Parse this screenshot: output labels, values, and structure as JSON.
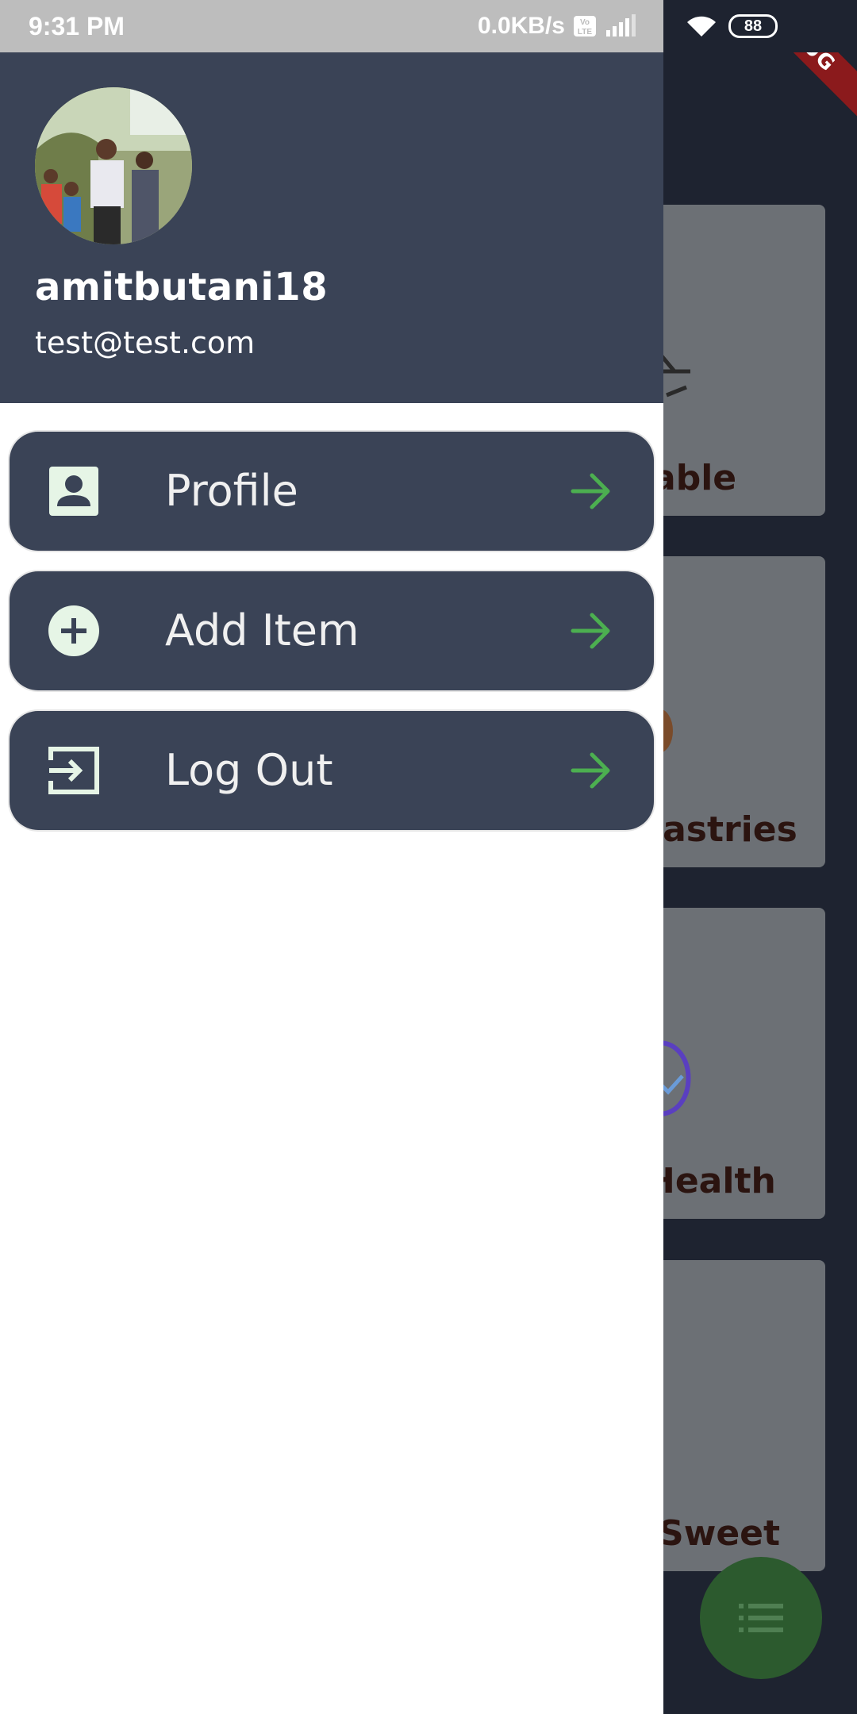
{
  "status_bar": {
    "time": "9:31 PM",
    "network_speed": "0.0KB/s",
    "battery": "88"
  },
  "debug_banner": "DEBUG",
  "drawer": {
    "username": "amitbutani18",
    "email": "test@test.com",
    "items": [
      {
        "label": "Profile",
        "icon": "person-badge-icon"
      },
      {
        "label": "Add Item",
        "icon": "add-circle-icon"
      },
      {
        "label": "Log Out",
        "icon": "logout-icon"
      }
    ]
  },
  "background": {
    "categories": [
      {
        "label": "able"
      },
      {
        "label": "Pastries"
      },
      {
        "label": "Health"
      },
      {
        "label": "Sweet"
      }
    ]
  },
  "colors": {
    "drawer_header": "#3a4356",
    "menu_item_bg": "#3a4356",
    "arrow_accent": "#4caf50",
    "fab": "#2c5a2e"
  }
}
